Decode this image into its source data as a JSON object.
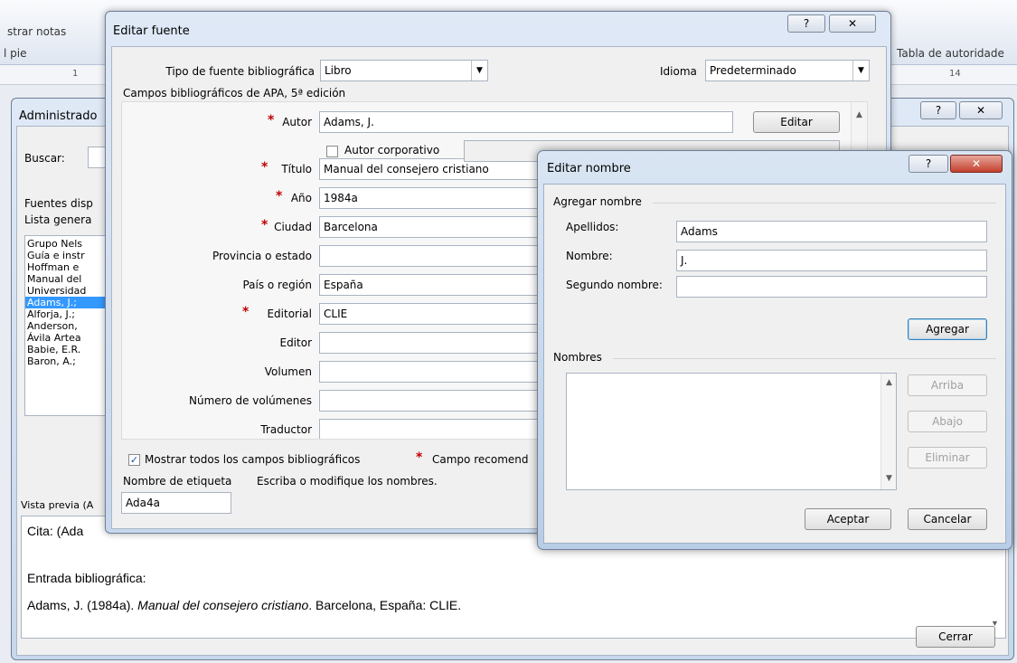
{
  "background": {
    "ribbon": {
      "left_text": "strar notas",
      "left_sub": "l pie",
      "right_text": "Tabla de autoridade",
      "ruler_left": "1",
      "ruler_right": "14"
    }
  },
  "admin": {
    "title": "Administrado",
    "search_label": "Buscar:",
    "sources_label": "Fuentes disp",
    "list_label": "Lista genera",
    "list_items": [
      "Grupo Nels",
      "Guía e instr",
      "Hoffman e",
      "Manual del",
      "Universidad",
      "Adams, J.;",
      "Alforja, J.;",
      "Anderson,",
      "Ávila Artea",
      "Babie, E.R.",
      "Baron, A.;"
    ],
    "selected_index": 5,
    "preview_label": "Vista previa (A",
    "preview_cite": "Cita:  (Ada",
    "preview_bib_label": "Entrada bibliográfica:",
    "preview_bib_pre": "Adams, J. (1984a). ",
    "preview_bib_title": "Manual del consejero cristiano",
    "preview_bib_post": ". Barcelona, España: CLIE.",
    "close_button": "Cerrar"
  },
  "editar_fuente": {
    "title": "Editar fuente",
    "source_type_label": "Tipo de fuente bibliográfica",
    "source_type_value": "Libro",
    "language_label": "Idioma",
    "language_value": "Predeterminado",
    "group_label": "Campos bibliográficos de APA, 5ª edición",
    "fields": [
      {
        "label": "Autor",
        "value": "Adams, J.",
        "required": true
      },
      {
        "label": "Título",
        "value": "Manual del consejero cristiano",
        "required": true
      },
      {
        "label": "Año",
        "value": "1984a",
        "required": true
      },
      {
        "label": "Ciudad",
        "value": "Barcelona",
        "required": true
      },
      {
        "label": "Provincia o estado",
        "value": "",
        "required": false
      },
      {
        "label": "País o región",
        "value": "España",
        "required": false
      },
      {
        "label": "Editorial",
        "value": "CLIE",
        "required": true
      },
      {
        "label": "Editor",
        "value": "",
        "required": false
      },
      {
        "label": "Volumen",
        "value": "",
        "required": false
      },
      {
        "label": "Número de volúmenes",
        "value": "",
        "required": false
      },
      {
        "label": "Traductor",
        "value": "",
        "required": false
      }
    ],
    "edit_button": "Editar",
    "corporate_label": "Autor corporativo",
    "show_all_label": "Mostrar todos los campos bibliográficos",
    "show_all_checked": true,
    "recommended_label": "Campo recomend",
    "tag_label": "Nombre de etiqueta",
    "tag_hint": "Escriba o modifique los nombres.",
    "tag_value": "Ada4a"
  },
  "editar_nombre": {
    "title": "Editar nombre",
    "add_group": "Agregar nombre",
    "last_label": "Apellidos:",
    "last_value": "Adams",
    "first_label": "Nombre:",
    "first_value": "J.",
    "middle_label": "Segundo nombre:",
    "middle_value": "",
    "add_button": "Agregar",
    "names_label": "Nombres",
    "up_button": "Arriba",
    "down_button": "Abajo",
    "delete_button": "Eliminar",
    "ok_button": "Aceptar",
    "cancel_button": "Cancelar"
  },
  "icons": {
    "help": "help-icon",
    "close": "close-icon"
  }
}
